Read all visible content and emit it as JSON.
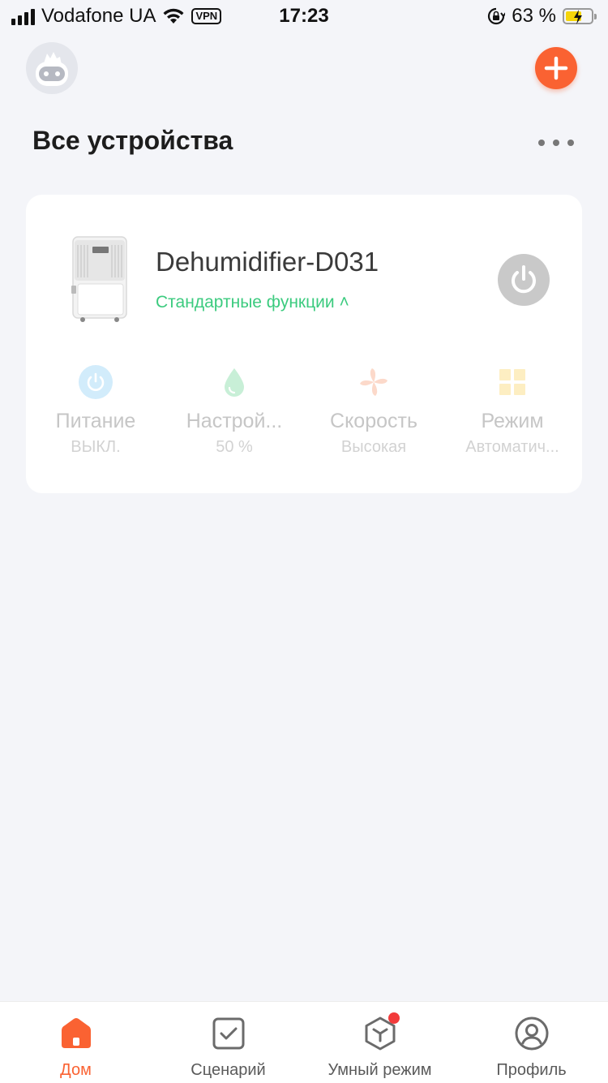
{
  "status_bar": {
    "carrier": "Vodafone UA",
    "vpn": "VPN",
    "time": "17:23",
    "battery": "63 %",
    "battery_level": 0.63
  },
  "header": {
    "title": "Все устройства"
  },
  "device": {
    "name": "Dehumidifier-D031",
    "status_link": "Стандартные функции ˄",
    "controls": [
      {
        "label": "Питание",
        "value": "ВЫКЛ.",
        "icon": "power-icon",
        "color": "#4db8f5"
      },
      {
        "label": "Настрой...",
        "value": "50 %",
        "icon": "water-drop-icon",
        "color": "#3ccb7f"
      },
      {
        "label": "Скорость",
        "value": "Высокая",
        "icon": "fan-icon",
        "color": "#fa6232"
      },
      {
        "label": "Режим",
        "value": "Автоматич...",
        "icon": "mode-grid-icon",
        "color": "#f5c23b"
      }
    ]
  },
  "tabs": [
    {
      "label": "Дом",
      "icon": "home-icon",
      "active": true
    },
    {
      "label": "Сценарий",
      "icon": "scenario-check-icon",
      "active": false
    },
    {
      "label": "Умный режим",
      "icon": "smart-cube-icon",
      "active": false
    },
    {
      "label": "Профиль",
      "icon": "profile-icon",
      "active": false
    }
  ],
  "colors": {
    "accent": "#fa6232",
    "green": "#3ccb7f",
    "background": "#f4f5f9"
  }
}
